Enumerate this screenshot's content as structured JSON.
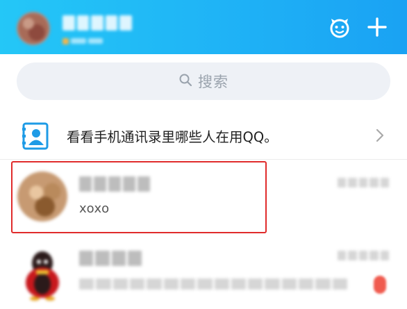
{
  "header": {
    "pet_icon": "qq-pet-icon",
    "plus_icon": "plus-icon",
    "accent_color": "#1fb3f6"
  },
  "search": {
    "placeholder": "搜索",
    "icon": "search-icon"
  },
  "contacts_banner": {
    "text": "看看手机通讯录里哪些人在用QQ。",
    "icon": "contact-book-icon"
  },
  "chats": [
    {
      "preview": "xoxo",
      "highlighted": true
    },
    {
      "preview": ""
    }
  ],
  "colors": {
    "highlight_border": "#e02b2b",
    "unread_badge": "#f05b4f"
  }
}
